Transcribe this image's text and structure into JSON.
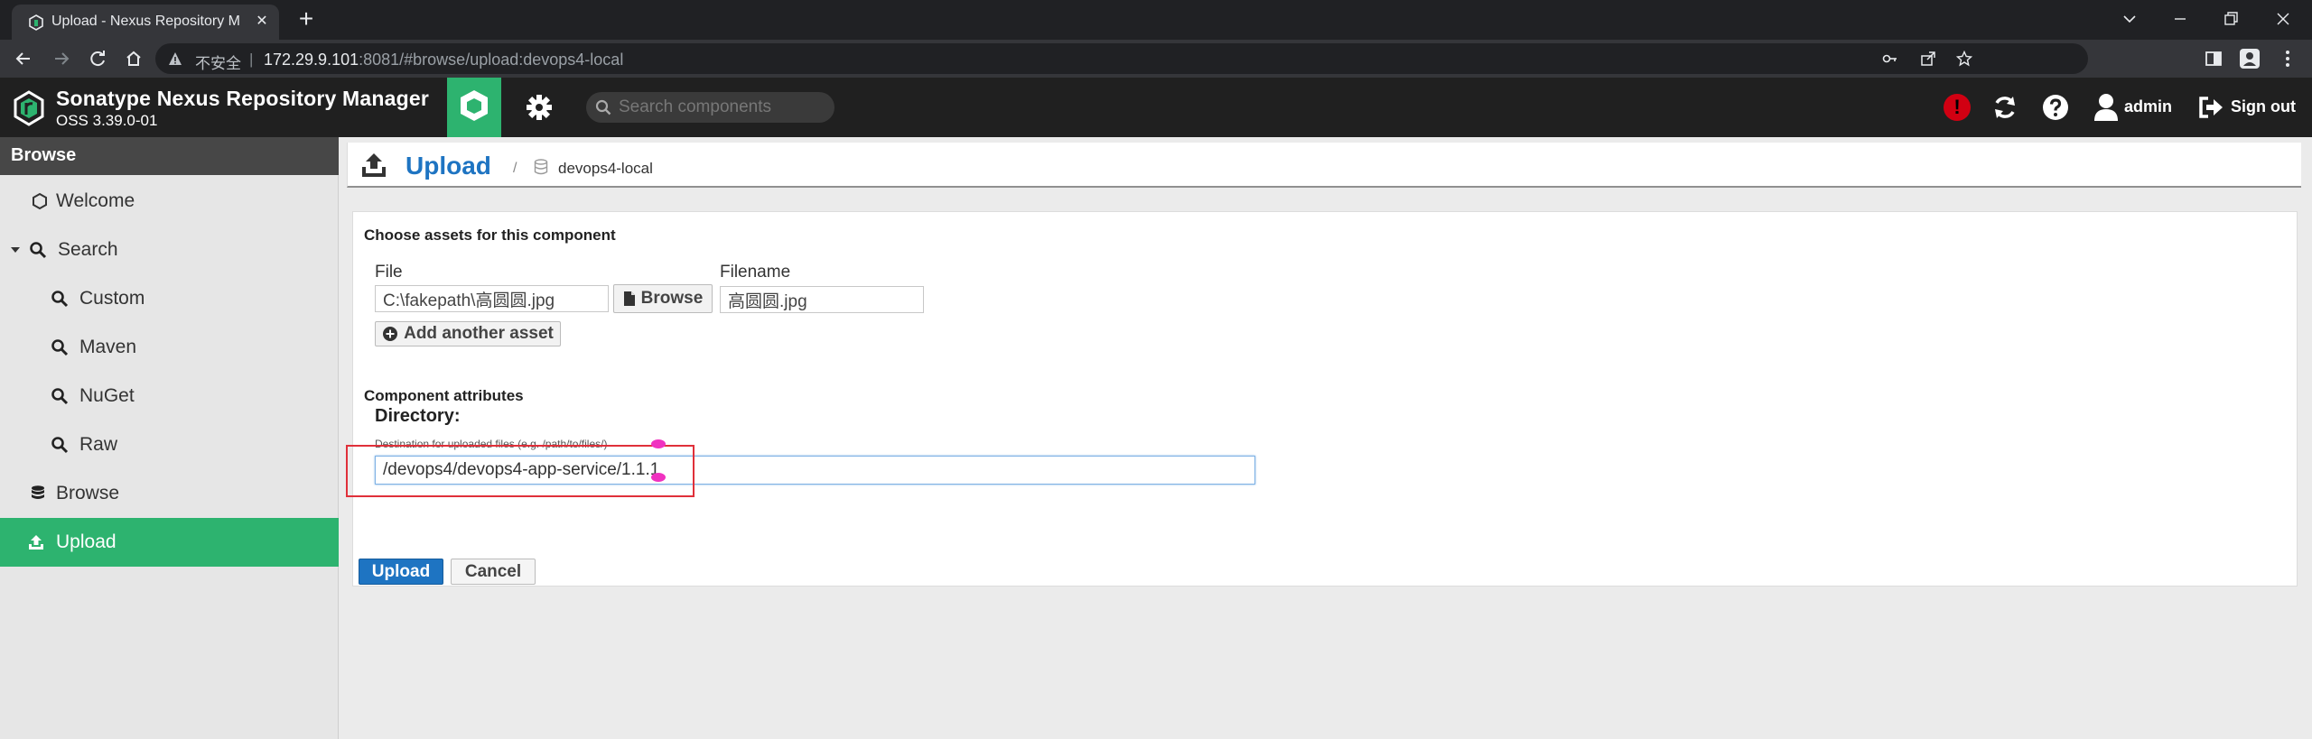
{
  "browser": {
    "tab_title": "Upload - Nexus Repository Ma",
    "insecure_label": "不安全",
    "url_host": "172.29.9.101",
    "url_rest": ":8081/#browse/upload:devops4-local",
    "new_tab_symbol": "+",
    "close_symbol": "✕"
  },
  "header": {
    "product_name": "Sonatype Nexus Repository Manager",
    "version": "OSS 3.39.0-01",
    "search_placeholder": "Search components",
    "alert_symbol": "!",
    "user": "admin",
    "signout": "Sign out"
  },
  "sidebar": {
    "heading": "Browse",
    "items": [
      {
        "label": "Welcome",
        "icon": "hexagon-icon"
      },
      {
        "label": "Search",
        "icon": "search-icon"
      },
      {
        "label": "Custom",
        "icon": "search-icon"
      },
      {
        "label": "Maven",
        "icon": "search-icon"
      },
      {
        "label": "NuGet",
        "icon": "search-icon"
      },
      {
        "label": "Raw",
        "icon": "search-icon"
      },
      {
        "label": "Browse",
        "icon": "database-icon"
      },
      {
        "label": "Upload",
        "icon": "upload-icon",
        "active": true
      }
    ]
  },
  "breadcrumb": {
    "title": "Upload",
    "separator": "/",
    "repository": "devops4-local"
  },
  "form": {
    "assets_heading": "Choose assets for this component",
    "file_label": "File",
    "file_value": "C:\\fakepath\\高圆圆.jpg",
    "browse_button": "Browse",
    "filename_label": "Filename",
    "filename_value": "高圆圆.jpg",
    "add_asset_button": "Add another asset",
    "attributes_heading": "Component attributes",
    "directory_label": "Directory:",
    "directory_hint": "Destination for uploaded files (e.g. /path/to/files/)",
    "directory_value": "/devops4/devops4-app-service/1.1.1",
    "upload_button": "Upload",
    "cancel_button": "Cancel"
  },
  "colors": {
    "accent_green": "#2db36f",
    "link_blue": "#1e74c2",
    "alert_red": "#d10012",
    "annotation_red": "#e0303a"
  }
}
